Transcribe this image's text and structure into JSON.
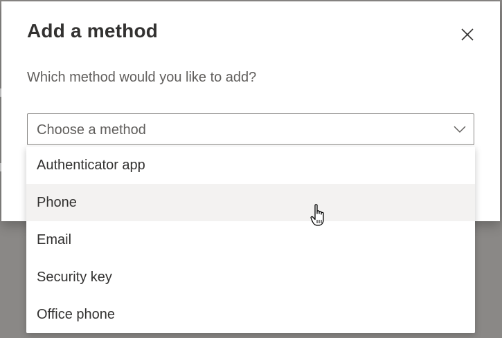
{
  "dialog": {
    "title": "Add a method",
    "prompt": "Which method would you like to add?",
    "close_icon": "close-icon"
  },
  "method_select": {
    "placeholder": "Choose a method",
    "chevron_icon": "chevron-down-icon",
    "expanded": true,
    "options": [
      {
        "label": "Authenticator app"
      },
      {
        "label": "Phone",
        "hovered": true
      },
      {
        "label": "Email"
      },
      {
        "label": "Security key"
      },
      {
        "label": "Office phone"
      }
    ]
  },
  "cursor": {
    "icon": "hand-pointer-icon"
  },
  "colors": {
    "overlay": "#8a8886",
    "hover_background": "#f3f2f1",
    "title_text": "#323130",
    "secondary_text": "#605e5c"
  }
}
